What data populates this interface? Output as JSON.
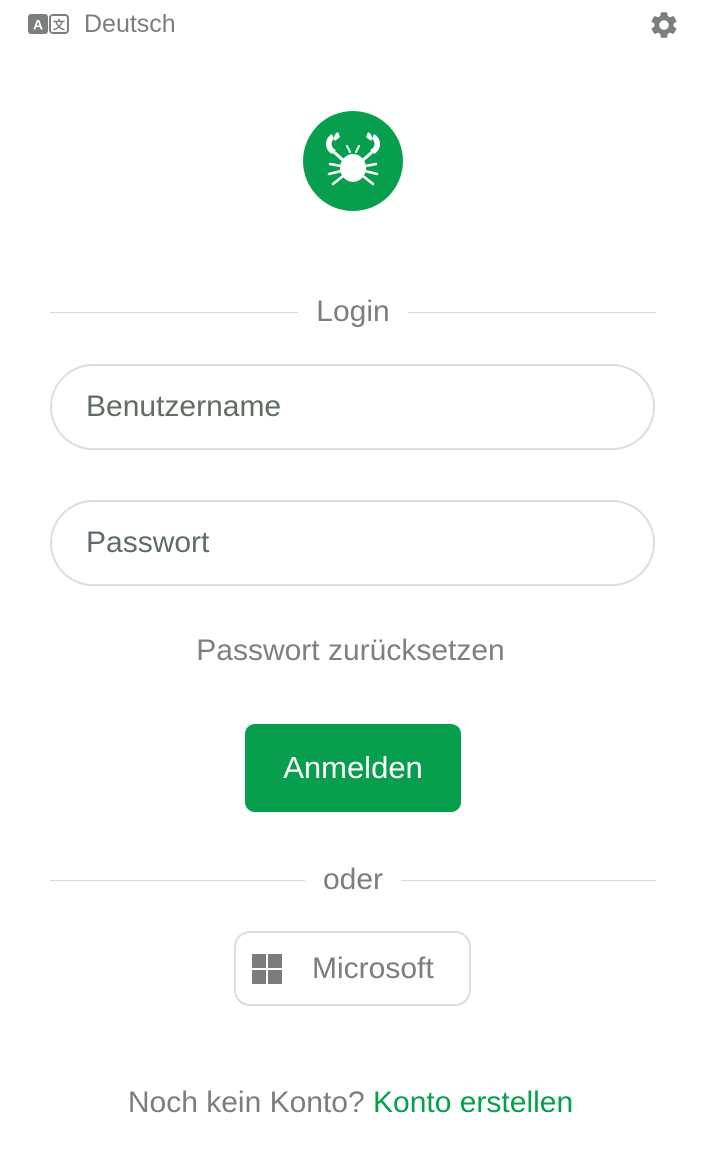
{
  "header": {
    "language_label": "Deutsch",
    "language_icon": "translate-icon",
    "settings_icon": "gear-icon"
  },
  "brand": {
    "logo_icon": "crab-logo-icon",
    "accent_color": "#079f4d"
  },
  "login": {
    "section_title": "Login",
    "username_placeholder": "Benutzername",
    "password_placeholder": "Passwort",
    "reset_password_label": "Passwort zurücksetzen",
    "submit_label": "Anmelden"
  },
  "alternative": {
    "divider_label": "oder",
    "microsoft_label": "Microsoft",
    "microsoft_icon": "windows-icon"
  },
  "signup": {
    "prompt": "Noch kein Konto?",
    "link_label": "Konto erstellen"
  }
}
